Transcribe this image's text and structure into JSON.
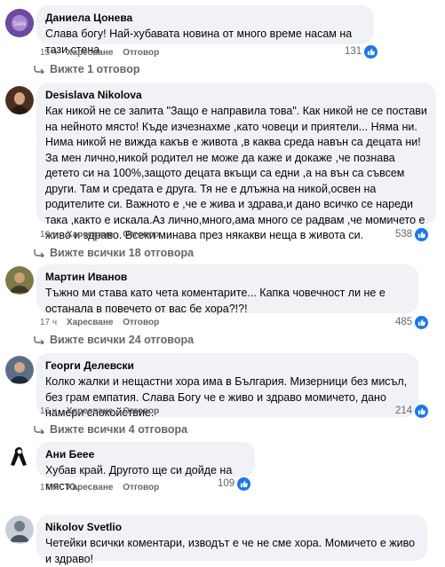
{
  "comments": [
    {
      "author": "Даниела Цонева",
      "text": "Слава богу! Най-хубавата новина от много време насам на тази стена.",
      "time": "15 ч",
      "like_label": "Харесване",
      "reply_label": "Отговор",
      "reactions": "131",
      "replies": "Вижте 1 отговор",
      "avatar_color": "#6b4aa0"
    },
    {
      "author": "Desislava Nikolova",
      "text": "Как никой не се запита \"Защо е направила това\". Как никой не се постави на нейното място! Къде изчезнахме ,като човеци и приятели... Няма ни. Нима никой не вижда какъв е живота ,в каква среда навън са децата ни! За мен лично,никой родител не може да каже и докаже ,че познава детето си на 100%,защото децата вкъщи са едни ,а на вън са съвсем други. Там и средата е друга. Тя не е длъжна на никой,освен на родителите си. Важното е ,че е жива и здрава,и дано всичко се нареди така ,както е искала.Аз лично,много,ама много се радвам ,че момичето е живо и здраво. Всеки минава през някакви неща в живота си.",
      "time": "16 ч",
      "like_label": "Харесване",
      "reply_label": "Отговор",
      "reactions": "538",
      "replies": "Вижте всички 18 отговора",
      "avatar_color": "#8a5a3c"
    },
    {
      "author": "Мартин Иванов",
      "text": "Тъжно ми става като чета коментарите... Капка човечност ли не е останала в повечето от вас бе хора?!?!",
      "time": "17 ч",
      "like_label": "Харесване",
      "reply_label": "Отговор",
      "reactions": "485",
      "replies": "Вижте всички 24 отговора",
      "avatar_color": "#6e6a3a"
    },
    {
      "author": "Георги Делевски",
      "text": "Колко жалки и нещастни хора има в България. Мизерници без мисъл, без грам емпатия. Слава Богу че е живо и здраво момичето, дано намери спокойствие.",
      "time": "16 ч",
      "like_label": "Харесване",
      "reply_label": "Отговор",
      "reactions": "214",
      "replies": "Вижте всички 4 отговора",
      "avatar_color": "#3c4a5e"
    },
    {
      "author": "Ани Бееe",
      "text": "Хубав край. Другото ще си дойде на място.",
      "time": "17 ч",
      "like_label": "Харесване",
      "reply_label": "Отговор",
      "reactions": "109",
      "replies": "",
      "avatar_color": "#ffffff"
    },
    {
      "author": "Nikolov Svetlio",
      "text": "Четейки всички коментари, изводът е че не сме хора. Момичето е живо и здраво!",
      "time": "",
      "like_label": "",
      "reply_label": "",
      "reactions": "",
      "replies": "",
      "avatar_color": "#9aa4ad"
    }
  ]
}
